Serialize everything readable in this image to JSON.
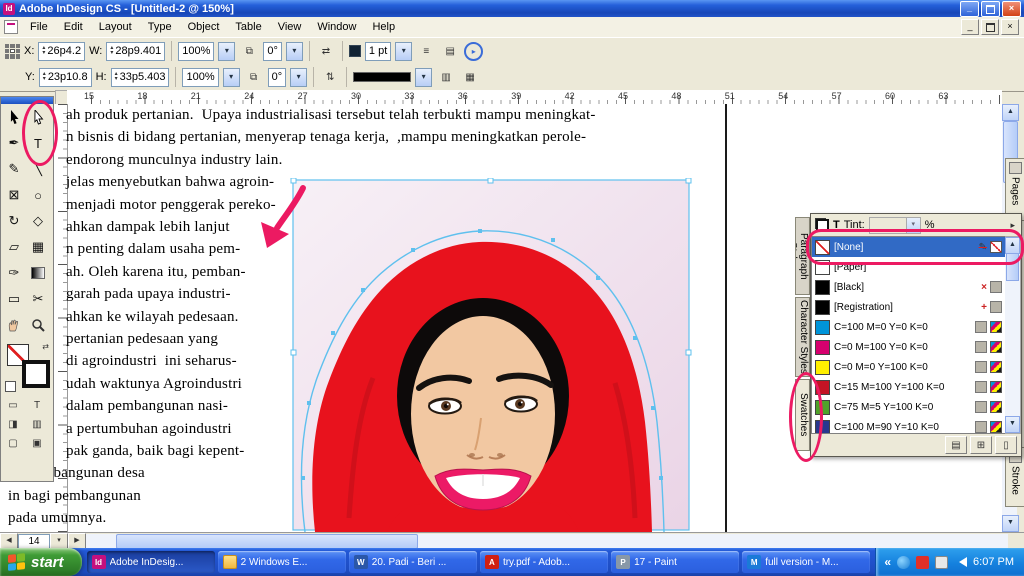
{
  "colors": {
    "annotation": "#EC1A62",
    "hijab_red": "#E8121D",
    "hijab_shadow": "#BC0E18",
    "band_black": "#0D0A0A",
    "skin": "#F2C8A2",
    "lip_pink": "#EC1A66",
    "selection_blue": "#5FC0EE",
    "frame_pink_1": "#F7F0F6",
    "frame_pink_2": "#EAD4E6"
  },
  "titlebar": {
    "title": "Adobe InDesign CS - [Untitled-2 @ 150%]"
  },
  "menubar": {
    "items": [
      "File",
      "Edit",
      "Layout",
      "Type",
      "Object",
      "Table",
      "View",
      "Window",
      "Help"
    ]
  },
  "control": {
    "x_label": "X:",
    "x": "26p4.2",
    "y_label": "Y:",
    "y": "23p10.8",
    "w_label": "W:",
    "w": "28p9.401",
    "h_label": "H:",
    "h": "33p5.403",
    "scale_x": "100%",
    "scale_y": "100%",
    "shear": "0°",
    "rotation": "0°",
    "stroke_weight": "1 pt"
  },
  "ruler": {
    "numbers": [
      "15",
      "18",
      "21",
      "24",
      "27",
      "30",
      "33",
      "36",
      "39",
      "42",
      "45",
      "48",
      "51",
      "54",
      "57",
      "60",
      "63"
    ]
  },
  "toolbox": {
    "tools": [
      {
        "name": "selection-tool",
        "glyph": "black-arrow"
      },
      {
        "name": "direct-selection-tool",
        "glyph": "white-arrow"
      },
      {
        "name": "pen-tool",
        "glyph": "pen"
      },
      {
        "name": "type-tool",
        "glyph": "type"
      },
      {
        "name": "pencil-tool",
        "glyph": "pencil"
      },
      {
        "name": "line-tool",
        "glyph": "line"
      },
      {
        "name": "frame-tool",
        "glyph": "frame"
      },
      {
        "name": "ellipse-tool",
        "glyph": "ellipse"
      },
      {
        "name": "rotate-tool",
        "glyph": "rotate"
      },
      {
        "name": "scale-tool",
        "glyph": "scale"
      },
      {
        "name": "shear-tool",
        "glyph": "shear"
      },
      {
        "name": "free-transform-tool",
        "glyph": "free-transform"
      },
      {
        "name": "eyedropper-tool",
        "glyph": "eyedropper"
      },
      {
        "name": "gradient-tool",
        "glyph": "gradient"
      },
      {
        "name": "button-tool",
        "glyph": "button"
      },
      {
        "name": "scissors-tool",
        "glyph": "scissors"
      },
      {
        "name": "hand-tool",
        "glyph": "hand"
      },
      {
        "name": "zoom-tool",
        "glyph": "zoom"
      }
    ]
  },
  "document": {
    "page_number": "14",
    "text_lines": [
      "ah produk pertanian.  Upaya industrialisasi tersebut telah terbukti mampu meningkat-",
      "n bisnis di bidang pertanian, menyerap tenaga kerja,  ,mampu meningkatkan perole-",
      "endorong munculnya industry lain.",
      "jelas menyebutkan bahwa agroin-",
      "menjadi motor penggerak pereko-",
      "ahkan dampak lebih lanjut",
      "n penting dalam usaha pem-",
      "ah. Oleh karena itu, pemban-",
      "garah pada upaya industri-",
      "ahkan ke wilayah pedesaan.",
      "pertanian pedesaan yang",
      "di agroindustri  ini seharus-",
      "udah waktunya Agroindustri",
      "dalam pembangunan nasi-",
      "a pertumbuhan agoindustri",
      "pak ganda, baik bagi kepent-",
      "al, pembangunan desa",
      "in bagi pembangunan",
      "pada umumnya."
    ]
  },
  "swatches": {
    "tint_label": "Tint:",
    "tint_unit": "%",
    "side_tabs": [
      "Paragraph Styles",
      "Character Styles",
      "Swatches"
    ],
    "items": [
      {
        "label": "[None]",
        "type": "none",
        "selected": true,
        "icons": [
          "pencil-none",
          "none-box"
        ]
      },
      {
        "label": "[Paper]",
        "color": "#FFFFFF",
        "icons": []
      },
      {
        "label": "[Black]",
        "color": "#000000",
        "icons": [
          "x-red",
          "gray-box"
        ]
      },
      {
        "label": "[Registration]",
        "color": "#000000",
        "icons": [
          "reg",
          "gray-box"
        ]
      },
      {
        "label": "C=100 M=0 Y=0 K=0",
        "color": "#0094D9",
        "icons": [
          "gray-box",
          "cmyk"
        ]
      },
      {
        "label": "C=0 M=100 Y=0 K=0",
        "color": "#D6006E",
        "icons": [
          "gray-box",
          "cmyk"
        ]
      },
      {
        "label": "C=0 M=0 Y=100 K=0",
        "color": "#FFEF00",
        "icons": [
          "gray-box",
          "cmyk"
        ]
      },
      {
        "label": "C=15 M=100 Y=100 K=0",
        "color": "#C41425",
        "icons": [
          "gray-box",
          "cmyk"
        ]
      },
      {
        "label": "C=75 M=5 Y=100 K=0",
        "color": "#4FA32A",
        "icons": [
          "gray-box",
          "cmyk"
        ]
      },
      {
        "label": "C=100 M=90 Y=10 K=0",
        "color": "#28388F",
        "icons": [
          "gray-box",
          "cmyk"
        ]
      }
    ]
  },
  "right_tabs": {
    "pages": "Pages",
    "stroke": "Stroke"
  },
  "taskbar": {
    "start_label": "start",
    "tasks": [
      {
        "label": "Adobe InDesig...",
        "icon": "indesign",
        "active": true
      },
      {
        "label": "2 Windows E...",
        "icon": "folder",
        "active": false
      },
      {
        "label": "20. Padi - Beri ...",
        "icon": "word",
        "active": false
      },
      {
        "label": "try.pdf - Adob...",
        "icon": "pdf",
        "active": false
      },
      {
        "label": "17 - Paint",
        "icon": "paint",
        "active": false
      },
      {
        "label": "full version - M...",
        "icon": "media",
        "active": false
      }
    ],
    "time": "6:07 PM"
  },
  "icon_glyphs": {
    "pen": "✒",
    "type": "T",
    "pencil": "✎",
    "line": "╲",
    "frame": "⊠",
    "ellipse": "○",
    "rotate": "↻",
    "scale": "◇",
    "shear": "▱",
    "free-transform": "▦",
    "eyedropper": "✑",
    "button": "▭",
    "scissors": "✂",
    "minimize": "_",
    "close": "×",
    "dropdown": "▾",
    "spin_up": "▴",
    "spin_down": "▾",
    "arrow_left": "◀",
    "arrow_right": "▶",
    "arrow_up": "▲",
    "arrow_down": "▼",
    "chevron": "«",
    "flyout": "▸",
    "swap": "⇄",
    "menu": "≡",
    "t": "T",
    "percent_combo": "▾"
  }
}
